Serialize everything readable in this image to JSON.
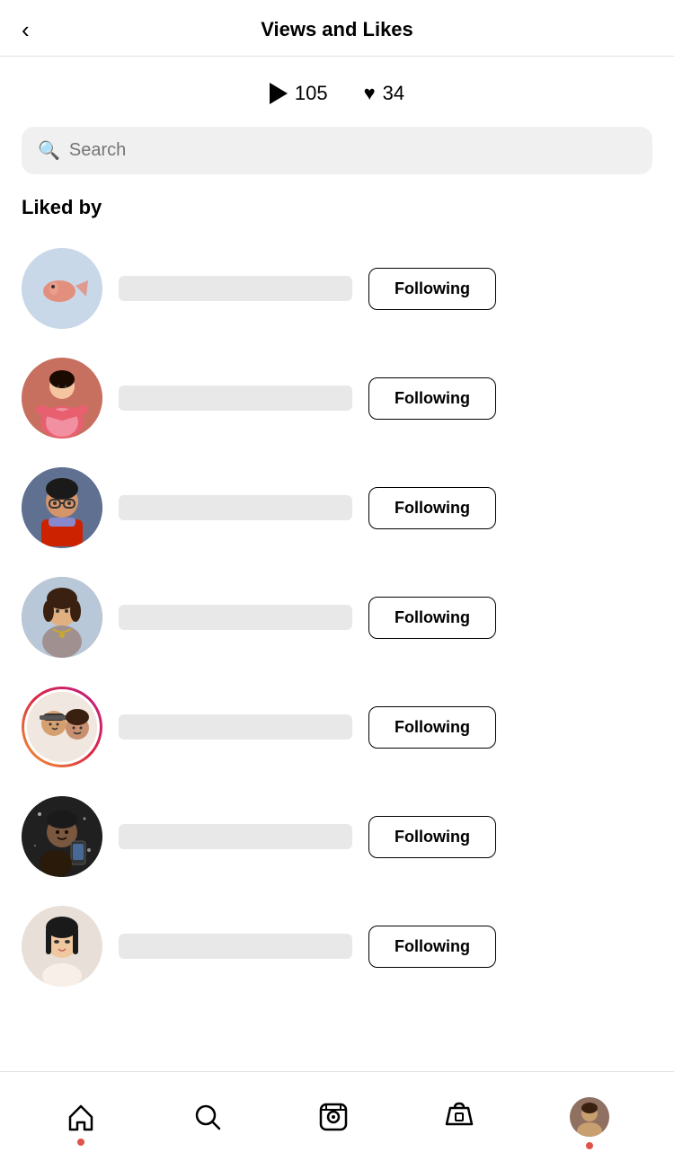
{
  "header": {
    "title": "Views and Likes",
    "back_label": "‹"
  },
  "stats": {
    "views_count": "105",
    "likes_count": "34"
  },
  "search": {
    "placeholder": "Search"
  },
  "section": {
    "liked_by_label": "Liked by"
  },
  "users": [
    {
      "id": 1,
      "following_label": "Following",
      "avatar_class": "av1",
      "story_ring": false
    },
    {
      "id": 2,
      "following_label": "Following",
      "avatar_class": "av2",
      "story_ring": false
    },
    {
      "id": 3,
      "following_label": "Following",
      "avatar_class": "av3",
      "story_ring": false
    },
    {
      "id": 4,
      "following_label": "Following",
      "avatar_class": "av4",
      "story_ring": false
    },
    {
      "id": 5,
      "following_label": "Following",
      "avatar_class": "av5",
      "story_ring": true
    },
    {
      "id": 6,
      "following_label": "Following",
      "avatar_class": "av6",
      "story_ring": false
    },
    {
      "id": 7,
      "following_label": "Following",
      "avatar_class": "av7",
      "story_ring": false
    }
  ],
  "nav": {
    "home_label": "home",
    "search_label": "search",
    "reels_label": "reels",
    "shop_label": "shop",
    "profile_label": "profile"
  }
}
